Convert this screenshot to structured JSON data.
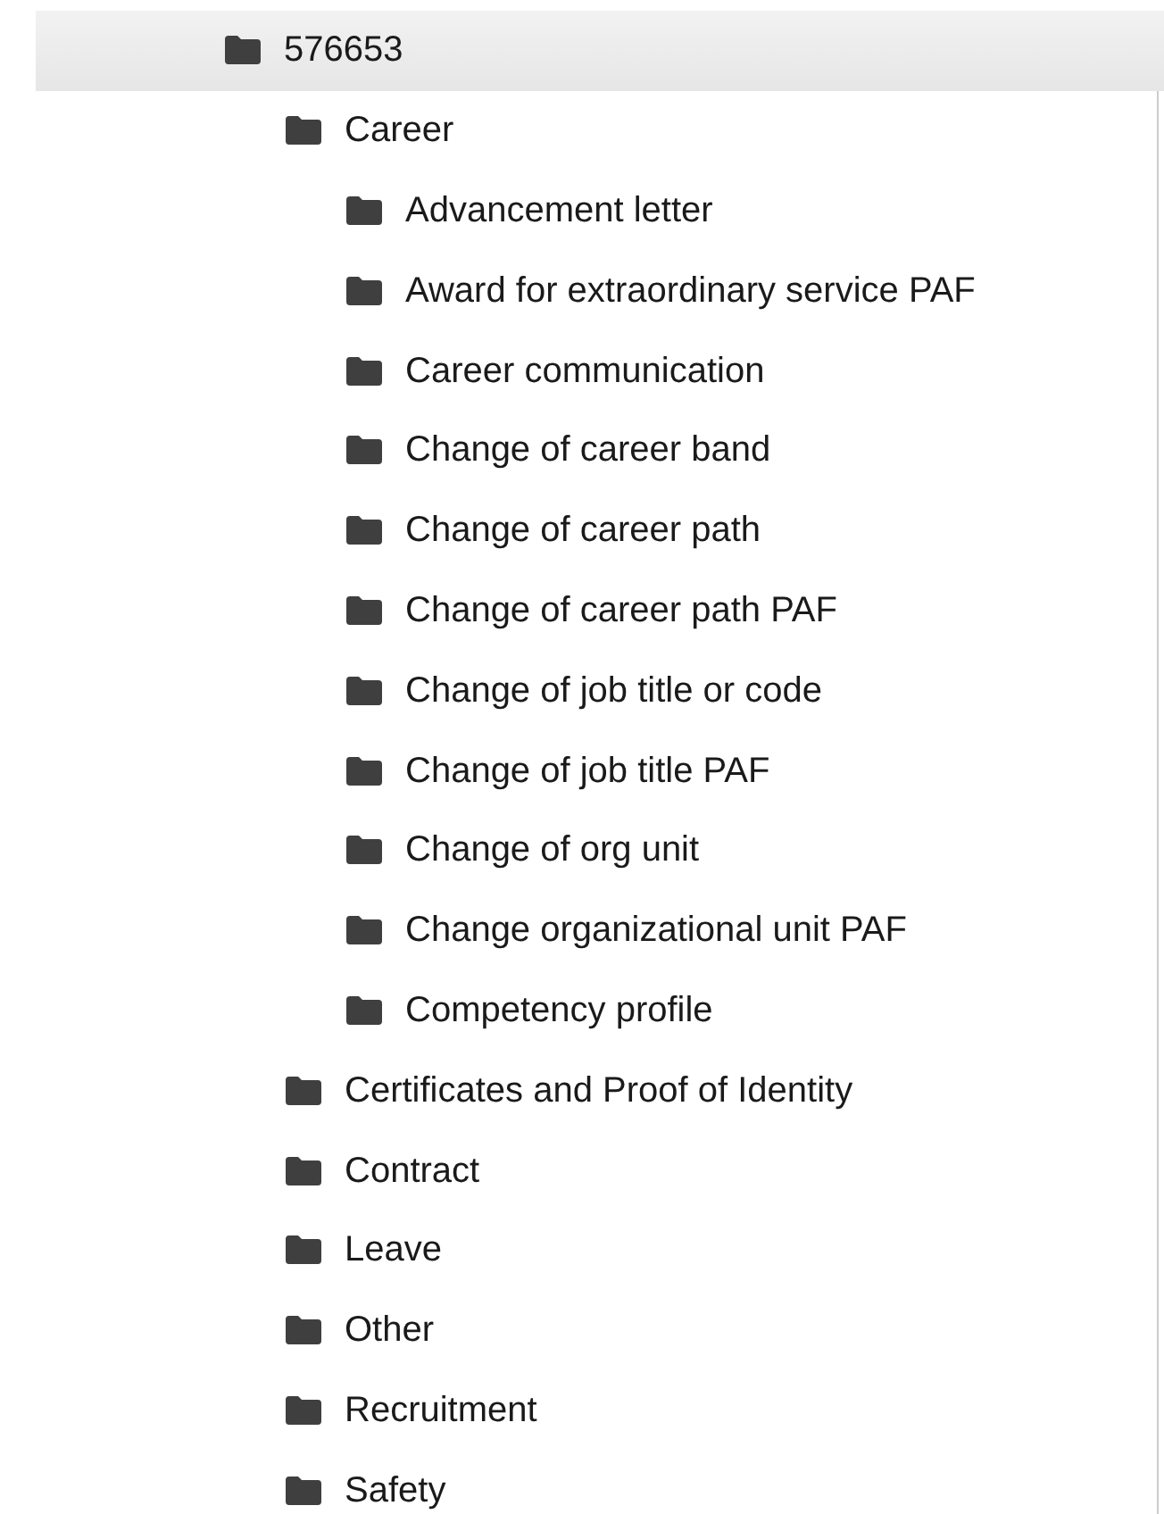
{
  "tree": [
    {
      "label": "576653",
      "selected": true,
      "children": [
        {
          "label": "Career",
          "selected": false,
          "children": [
            {
              "label": "Advancement letter",
              "selected": false
            },
            {
              "label": "Award for extraordinary service PAF",
              "selected": false
            },
            {
              "label": "Career communication",
              "selected": false
            },
            {
              "label": "Change of career band",
              "selected": false
            },
            {
              "label": "Change of career path",
              "selected": false
            },
            {
              "label": "Change of career path PAF",
              "selected": false
            },
            {
              "label": "Change of job title or code",
              "selected": false
            },
            {
              "label": "Change of job title PAF",
              "selected": false
            },
            {
              "label": "Change of org unit",
              "selected": false
            },
            {
              "label": "Change organizational unit PAF",
              "selected": false
            },
            {
              "label": "Competency profile",
              "selected": false
            }
          ]
        },
        {
          "label": "Certificates and Proof of Identity",
          "selected": false
        },
        {
          "label": "Contract",
          "selected": false
        },
        {
          "label": "Leave",
          "selected": false
        },
        {
          "label": "Other",
          "selected": false
        },
        {
          "label": "Recruitment",
          "selected": false
        },
        {
          "label": "Safety",
          "selected": false
        }
      ]
    }
  ]
}
